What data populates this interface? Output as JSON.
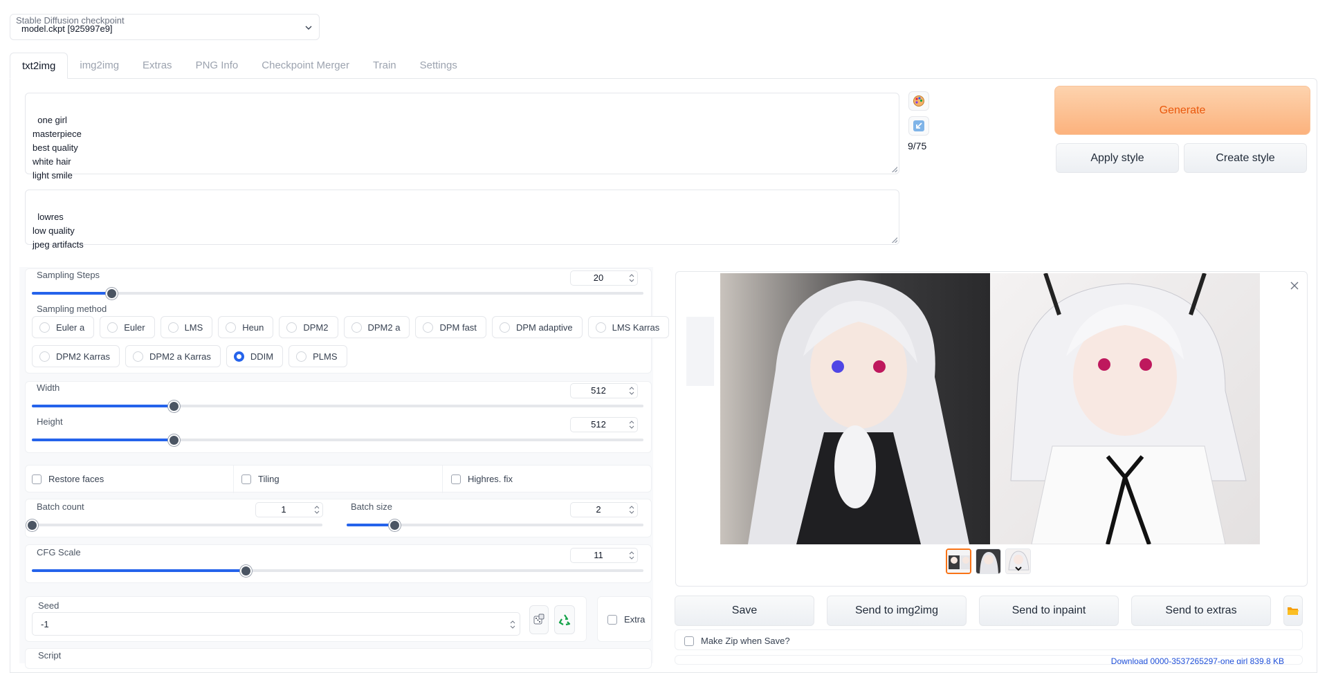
{
  "checkpoint": {
    "label": "Stable Diffusion checkpoint",
    "value": "model.ckpt [925997e9]"
  },
  "tabs": [
    "txt2img",
    "img2img",
    "Extras",
    "PNG Info",
    "Checkpoint Merger",
    "Train",
    "Settings"
  ],
  "prompt": {
    "text": "one girl\nmasterpiece\nbest quality\nwhite hair\nlight smile",
    "token_count": "9/75"
  },
  "negative_prompt": {
    "text": "lowres\nlow quality\njpeg artifacts"
  },
  "actions": {
    "generate": "Generate",
    "apply_style": "Apply style",
    "create_style": "Create style"
  },
  "sampling_steps": {
    "label": "Sampling Steps",
    "value": "20",
    "fraction": 0.13
  },
  "sampling_method": {
    "label": "Sampling method",
    "options": [
      "Euler a",
      "Euler",
      "LMS",
      "Heun",
      "DPM2",
      "DPM2 a",
      "DPM fast",
      "DPM adaptive",
      "LMS Karras",
      "DPM2 Karras",
      "DPM2 a Karras",
      "DDIM",
      "PLMS"
    ],
    "selected": "DDIM"
  },
  "width": {
    "label": "Width",
    "value": "512",
    "fraction": 0.232
  },
  "height": {
    "label": "Height",
    "value": "512",
    "fraction": 0.232
  },
  "checkboxes": {
    "restore_faces": "Restore faces",
    "tiling": "Tiling",
    "highres_fix": "Highres. fix"
  },
  "batch_count": {
    "label": "Batch count",
    "value": "1",
    "fraction": 0.0
  },
  "batch_size": {
    "label": "Batch size",
    "value": "2",
    "fraction": 0.16
  },
  "cfg_scale": {
    "label": "CFG Scale",
    "value": "11",
    "fraction": 0.35
  },
  "seed": {
    "label": "Seed",
    "value": "-1",
    "extra_label": "Extra"
  },
  "script": {
    "label": "Script"
  },
  "output": {
    "save": "Save",
    "send_img2img": "Send to img2img",
    "send_inpaint": "Send to inpaint",
    "send_extras": "Send to extras",
    "make_zip": "Make Zip when Save?",
    "footer_text": "Download 0000-3537265297-one girl  839.8 KB"
  },
  "icons": {
    "style_icon": "palette-icon",
    "paste_icon": "arrow-icon",
    "dice": "dice-icon",
    "recycle": "recycle-icon",
    "close": "close-icon",
    "folder": "folder-icon"
  },
  "colors": {
    "accent": "#2563eb",
    "generate": "#fcb27d",
    "generate_text": "#ea580c"
  }
}
